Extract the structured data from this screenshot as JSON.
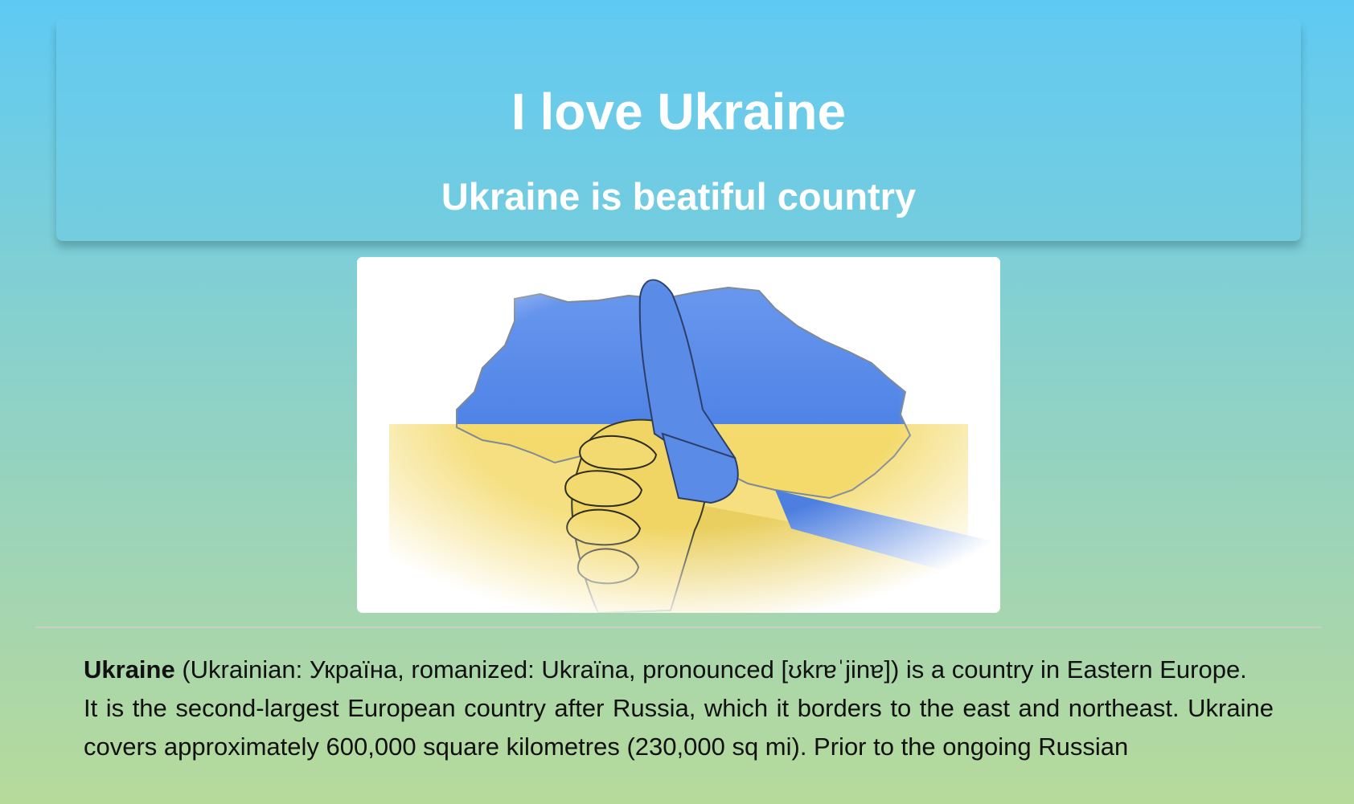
{
  "header": {
    "title": "I love Ukraine",
    "subtitle": "Ukraine is beatiful country"
  },
  "image": {
    "alt": "Thumbs up hand painted in Ukrainian flag colors over a map of Ukraine",
    "colors": {
      "blue": "#4f83e6",
      "yellow": "#f3d96a",
      "white": "#ffffff"
    }
  },
  "article": {
    "intro_bold": "Ukraine",
    "intro_rest": " (Ukrainian: Україна, romanized: Ukraïna, pronounced [ʊkrɐˈjinɐ]) is a country in Eastern Europe.",
    "para2": "It is the second-largest European country after Russia, which it borders to the east and northeast. Ukraine covers approximately 600,000 square kilometres (230,000 sq mi). Prior to the ongoing Russian"
  },
  "colors": {
    "hero_top": "#64caf1",
    "hero_bottom": "#74cdde",
    "page_top": "#5ecaf3",
    "page_bottom": "#b6da9a",
    "text": "#111111"
  }
}
